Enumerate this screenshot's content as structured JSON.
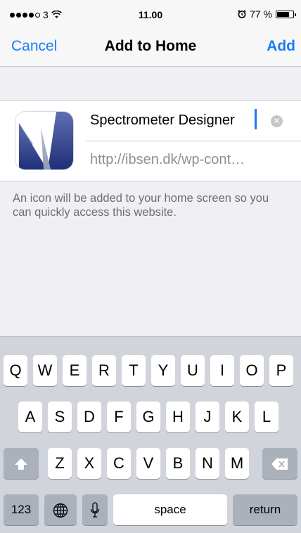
{
  "status_bar": {
    "carrier": "3",
    "time": "11.00",
    "battery": "77 %",
    "battery_level_percent": 77
  },
  "nav": {
    "cancel_label": "Cancel",
    "title": "Add to Home",
    "add_label": "Add"
  },
  "form": {
    "name_value": "Spectrometer Designer",
    "url": "http://ibsen.dk/wp-cont…",
    "hint": "An icon will be added to your home screen so you can quickly access this website."
  },
  "keyboard": {
    "row1": [
      "Q",
      "W",
      "E",
      "R",
      "T",
      "Y",
      "U",
      "I",
      "O",
      "P"
    ],
    "row2": [
      "A",
      "S",
      "D",
      "F",
      "G",
      "H",
      "J",
      "K",
      "L"
    ],
    "row3": [
      "Z",
      "X",
      "C",
      "V",
      "B",
      "N",
      "M"
    ],
    "numbers_label": "123",
    "space_label": "space",
    "return_label": "return"
  },
  "icons": {
    "wifi": "wifi-icon",
    "alarm": "alarm-icon",
    "battery": "battery-icon",
    "clear": "clear-icon",
    "shift": "shift-icon",
    "delete": "delete-icon",
    "globe": "globe-icon",
    "mic": "microphone-icon"
  },
  "colors": {
    "accent": "#1a7cf5",
    "background": "#efeff4",
    "keyboard": "#d1d5db",
    "app_icon_blue": "#2d3e8a"
  }
}
